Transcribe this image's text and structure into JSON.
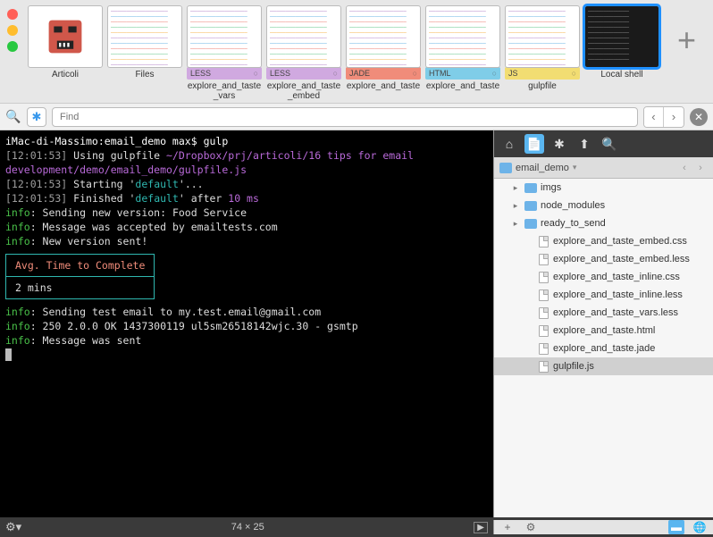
{
  "tabs": [
    {
      "label": "Articoli",
      "type": "",
      "type_class": ""
    },
    {
      "label": "Files",
      "type": "",
      "type_class": ""
    },
    {
      "label": "explore_and_taste_vars",
      "type": "LESS",
      "type_class": "tt-less"
    },
    {
      "label": "explore_and_taste_embed",
      "type": "LESS",
      "type_class": "tt-less"
    },
    {
      "label": "explore_and_taste",
      "type": "JADE",
      "type_class": "tt-jade"
    },
    {
      "label": "explore_and_taste",
      "type": "HTML",
      "type_class": "tt-html"
    },
    {
      "label": "gulpfile",
      "type": "JS",
      "type_class": "tt-js"
    },
    {
      "label": "Local shell",
      "type": "",
      "type_class": "",
      "selected": true,
      "dark": true
    }
  ],
  "search": {
    "placeholder": "Find"
  },
  "terminal": {
    "prompt": "iMac-di-Massimo:email_demo max$ ",
    "cmd": "gulp",
    "lines": [
      {
        "ts": "[12:01:53]",
        "pre": " Using gulpfile ",
        "path": "~/Dropbox/prj/articoli/16 tips for email development/demo/email_demo/gulpfile.js"
      },
      {
        "ts": "[12:01:53]",
        "text_a": " Starting '",
        "task": "default",
        "text_b": "'..."
      },
      {
        "ts": "[12:01:53]",
        "text_a": " Finished '",
        "task": "default",
        "text_b": "' after ",
        "dur": "10 ms"
      },
      {
        "info": "info",
        "text": ": Sending new version: Food Service"
      },
      {
        "info": "info",
        "text": ": Message was accepted by emailtests.com"
      },
      {
        "info": "info",
        "text": ": New version sent!"
      }
    ],
    "table": {
      "header": "Avg. Time to Complete",
      "value": "2 mins"
    },
    "lines2": [
      {
        "info": "info",
        "text": ": Sending test email to my.test.email@gmail.com"
      },
      {
        "info": "info",
        "text": ": 250 2.0.0 OK 1437300119 ul5sm26518142wjc.30 - gsmtp"
      },
      {
        "info": "info",
        "text": ": Message was sent"
      }
    ]
  },
  "breadcrumb": {
    "folder": "email_demo"
  },
  "tree": {
    "folders": [
      "imgs",
      "node_modules",
      "ready_to_send"
    ],
    "files": [
      "explore_and_taste_embed.css",
      "explore_and_taste_embed.less",
      "explore_and_taste_inline.css",
      "explore_and_taste_inline.less",
      "explore_and_taste_vars.less",
      "explore_and_taste.html",
      "explore_and_taste.jade",
      "gulpfile.js"
    ],
    "selected": "gulpfile.js"
  },
  "status": {
    "size": "74 × 25"
  }
}
